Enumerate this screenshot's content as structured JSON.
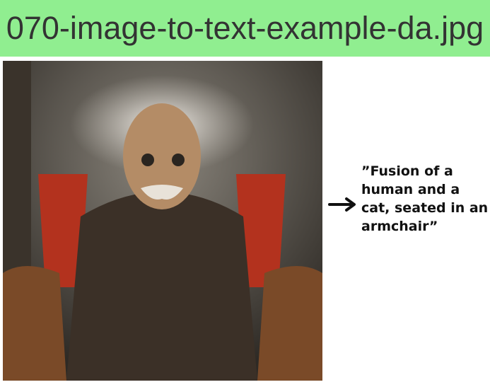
{
  "title": "070-image-to-text-example-da.jpg",
  "image": {
    "subject": "photo of an aged cat-human figure seated in a red armchair"
  },
  "arrow": {
    "icon": "arrow-right-icon"
  },
  "caption": "”Fusion of a human and a cat, seated in an armchair”",
  "colors": {
    "banner": "#90ee90",
    "chair": "#b03a22"
  }
}
